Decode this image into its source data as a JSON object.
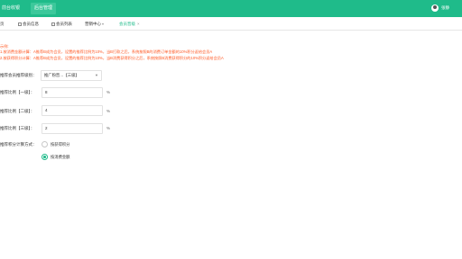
{
  "header": {
    "nav_front": "前台收银",
    "nav_admin": "后台管理",
    "user_name": "张静"
  },
  "tabs": [
    {
      "label": "页"
    },
    {
      "label": "会员信息"
    },
    {
      "label": "会员列表"
    },
    {
      "label": "营销中心"
    },
    {
      "label": "会员晋级"
    }
  ],
  "notice": {
    "title": "示例:",
    "line1": "1.按消费金额计算：A推荐B成为会员，设置的推荐比例为10%，当B打款之后，系统按照B的消费订单金额的10%积分返给会员A",
    "line2": "2.按获得积分计算：A推荐B成为会员，设置的推荐比例为10%，当B消费获得积分之后，系统按照B消费获得积分的10%积分返给会员A"
  },
  "form": {
    "level_label": "推荐会员推荐级别：",
    "level_value": "推广粉晋…【三级】",
    "ratio1_label": "推荐比例【一级】：",
    "ratio1_value": "8",
    "ratio2_label": "推荐比例【二级】：",
    "ratio2_value": "4",
    "ratio3_label": "推荐比例【三级】：",
    "ratio3_value": "2",
    "unit": "%",
    "calc_label": "推荐积分计算方式：",
    "option1": "按获得积分",
    "option2": "按消费金额",
    "selected_option": "按消费金额"
  },
  "colors": {
    "brand": "#1fbb8a",
    "warning": "#ff5722"
  },
  "icons": {
    "user": "user-avatar-icon",
    "tab": "tab-page-icon",
    "close": "close-icon",
    "dropdown": "chevron-down-icon"
  }
}
